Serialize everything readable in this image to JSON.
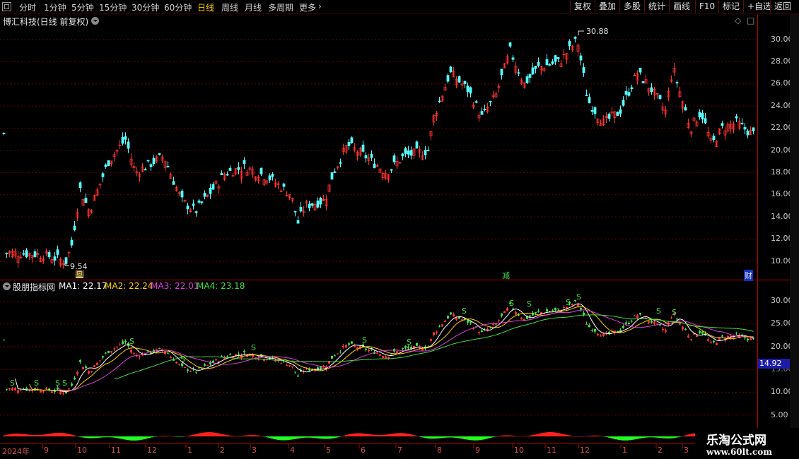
{
  "toolbar": {
    "periods": [
      "分时",
      "1分钟",
      "5分钟",
      "15分钟",
      "30分钟",
      "60分钟",
      "日线",
      "周线",
      "月线",
      "多周期",
      "更多"
    ],
    "active_period": "日线",
    "right_buttons": [
      "复权",
      "叠加",
      "多股",
      "统计",
      "画线",
      "F10",
      "标记",
      "+自选",
      "返回"
    ]
  },
  "main": {
    "title": "博汇科技(日线 前复权)",
    "y_ticks": [
      "30.00",
      "28.00",
      "26.00",
      "24.00",
      "22.00",
      "20.00",
      "18.00",
      "16.00",
      "14.00",
      "12.00",
      "10.00"
    ],
    "high_label": "30.88",
    "low_label": "9.54",
    "markers": {
      "first": "回",
      "mid": "减",
      "right": "财"
    }
  },
  "indicator": {
    "title": "股朋指标网",
    "ma": [
      {
        "label": "MA1: 22.17",
        "color": "#ffffff"
      },
      {
        "label": "MA2: 22.24",
        "color": "#ffd000"
      },
      {
        "label": "MA3: 22.01",
        "color": "#e040e0"
      },
      {
        "label": "MA4: 23.18",
        "color": "#40e040"
      }
    ],
    "y_ticks": [
      "30.00",
      "25.00",
      "20.00",
      "15.00",
      "10.00",
      "5.00"
    ],
    "current_value": "14.92",
    "signal": "S"
  },
  "x_axis": {
    "labels": [
      "2024年",
      "9",
      "10",
      "11",
      "12",
      "1",
      "2",
      "3",
      "4",
      "5",
      "6",
      "7",
      "8",
      "9",
      "10",
      "11",
      "12",
      "1",
      "2",
      "3"
    ]
  },
  "watermark": {
    "line1": "乐淘公式网",
    "line2": "www.60lt.com"
  },
  "colors": {
    "up": "#ff3232",
    "down": "#54ffff",
    "bg": "#000000",
    "grid": "#8b0000",
    "axis": "#c00000"
  },
  "icons": [
    "page-icon",
    "more-arrow-icon",
    "collapse-icon",
    "diamond-icon",
    "square-icon"
  ]
}
